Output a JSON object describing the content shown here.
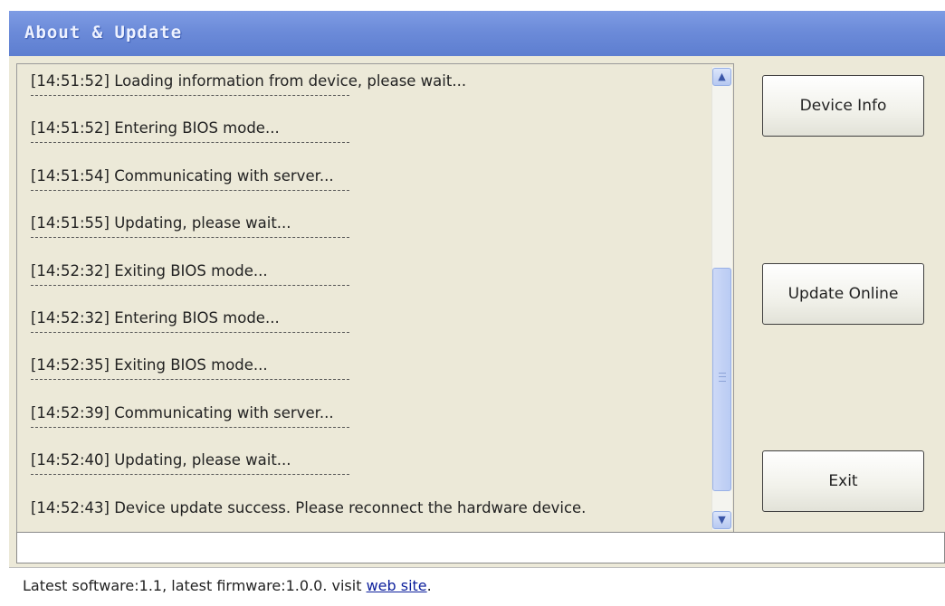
{
  "window": {
    "title": "About & Update"
  },
  "log": {
    "entries": [
      "[14:51:52] Loading information from device, please wait...",
      "[14:51:52] Entering BIOS mode...",
      "[14:51:54] Communicating with server...",
      "[14:51:55] Updating, please wait...",
      "[14:52:32] Exiting BIOS mode...",
      "[14:52:32] Entering BIOS mode...",
      "[14:52:35] Exiting BIOS mode...",
      "[14:52:39] Communicating with server...",
      "[14:52:40] Updating, please wait...",
      "[14:52:43] Device update success. Please reconnect the hardware device."
    ],
    "separator": "------------------------------------------"
  },
  "buttons": {
    "device_info": "Device Info",
    "update_online": "Update Online",
    "exit": "Exit"
  },
  "input": {
    "value": ""
  },
  "status": {
    "text": "Latest software:1.1, latest firmware:1.0.0. visit ",
    "link": "web site",
    "suffix": "."
  },
  "icons": {
    "scroll_up": "chevron-up-icon",
    "scroll_down": "chevron-down-icon"
  },
  "colors": {
    "titlebar": "#6c8bd9",
    "window_bg": "#ece9d8",
    "link": "#0c1f9c"
  }
}
